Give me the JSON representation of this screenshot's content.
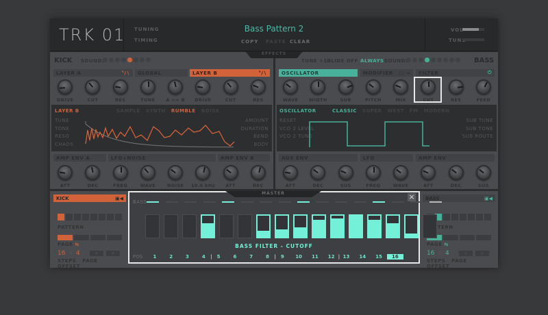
{
  "header": {
    "logo": "TRK 01",
    "tuning": "TUNING",
    "timing": "TIMING",
    "pattern_name": "Bass Pattern 2",
    "copy": "COPY",
    "paste": "PASTE",
    "clear": "CLEAR",
    "vol_label": "VOL",
    "tune_label": "TUNE",
    "vol_level": 0.75,
    "tune_level": 0.0
  },
  "tabs": {
    "effects": "EFFECTS",
    "master": "MASTER"
  },
  "kick": {
    "title": "KICK",
    "sounds": "SOUNDS",
    "sound_count": 8,
    "sound_active": 5,
    "sections": [
      {
        "label": "LAYER A"
      },
      {
        "label": "GLOBAL"
      },
      {
        "label": "LAYER B"
      }
    ],
    "knobs": [
      {
        "label": "DRIVE",
        "value": 0.15
      },
      {
        "label": "CUT",
        "value": 0.35
      },
      {
        "label": "RES",
        "value": 0.2
      },
      {
        "label": "TUNE",
        "value": 0.5
      },
      {
        "label": "A <> B",
        "value": 0.45
      },
      {
        "label": "DRIVE",
        "value": 0.2
      },
      {
        "label": "CUT",
        "value": 0.35
      },
      {
        "label": "RES",
        "value": 0.25
      }
    ],
    "display": {
      "title": "LAYER B",
      "modes": [
        "SAMPLE",
        "SYNTH",
        "RUMBLE",
        "NOISE"
      ],
      "active_mode": "RUMBLE",
      "left_params": [
        "TUNE",
        "TONE",
        "RESO",
        "CHAOS"
      ],
      "right_params": [
        "AMOUNT",
        "DURATION",
        "BEND",
        "BODY"
      ]
    },
    "env_sections": [
      {
        "label": "AMP ENV A"
      },
      {
        "label": "LFO+NOISE"
      },
      {
        "label": "AMP ENV B"
      }
    ],
    "env_knobs": [
      {
        "label": "ATT",
        "value": 0.2
      },
      {
        "label": "DEC",
        "value": 0.45
      },
      {
        "label": "FREQ",
        "value": 0.5
      },
      {
        "label": "WAVE",
        "value": 0.35
      },
      {
        "label": "NOISE",
        "value": 0.3
      },
      {
        "label": "10.0 kHz",
        "value": 0.55
      },
      {
        "label": "ATT",
        "value": 0.3
      },
      {
        "label": "DEC",
        "value": 0.55
      }
    ]
  },
  "bass": {
    "title": "BASS",
    "tune": "TUNE +12",
    "glide": "GLIDE OFF",
    "always": "ALWAYS",
    "sounds": "SOUNDS",
    "sound_count": 9,
    "sound_active": 4,
    "sections": [
      {
        "label": "OSCILLATOR"
      },
      {
        "label": "MODIFIER"
      },
      {
        "label": "FILTER"
      }
    ],
    "knobs": [
      {
        "label": "WAVE",
        "value": 0.3
      },
      {
        "label": "WIDTH",
        "value": 0.5
      },
      {
        "label": "SUB",
        "value": 0.75
      },
      {
        "label": "PITCH",
        "value": 0.3
      },
      {
        "label": "MIX",
        "value": 0.25
      },
      {
        "label": "CUT",
        "value": 0.5
      },
      {
        "label": "RES",
        "value": 0.8
      },
      {
        "label": "FEED",
        "value": 0.6
      }
    ],
    "display": {
      "title": "OSCILLATOR",
      "modes": [
        "CLASSIC",
        "SUPER",
        "WEST",
        "FM",
        "MODERN"
      ],
      "active_mode": "CLASSIC",
      "left_params": [
        "RESET",
        "VCO 2 LEVEL",
        "VCO 2 TUNE"
      ],
      "right_params": [
        "SUB TUNE",
        "SUB TONE",
        "SUB ROUTE"
      ]
    },
    "env_sections": [
      {
        "label": "AUX ENV"
      },
      {
        "label": "LFO"
      },
      {
        "label": "AMP ENV"
      }
    ],
    "env_knobs": [
      {
        "label": "ATT",
        "value": 0.2
      },
      {
        "label": "DEC",
        "value": 0.3
      },
      {
        "label": "SUS",
        "value": 0.25
      },
      {
        "label": "FREQ",
        "value": 0.5
      },
      {
        "label": "WAVE",
        "value": 0.3
      },
      {
        "label": "ATT",
        "value": 0.25
      },
      {
        "label": "DEC",
        "value": 0.3
      },
      {
        "label": "SUS",
        "value": 0.3
      }
    ]
  },
  "seq_kick": {
    "title": "KICK",
    "pattern": "PATTERN",
    "page": "PAGE",
    "steps": "16",
    "page_count": "4",
    "x": "×",
    "steps_label": "STEPS",
    "page_label": "PAGE",
    "offset_label": "OFFSET",
    "prev": "«",
    "next": "»",
    "active_pattern": 1
  },
  "seq_bass": {
    "title": "BASS",
    "pattern": "PATTERN",
    "page": "PAGE",
    "steps": "16",
    "page_count": "4",
    "x": "×",
    "steps_label": "STEPS",
    "page_label": "PAGE",
    "offset_label": "OFFSET",
    "prev": "«",
    "next": "»",
    "active_pattern": 2
  },
  "master": {
    "track": "BASS",
    "param": "BASS FILTER - CUTOFF",
    "pos_label": "POS",
    "close": "×",
    "steps": [
      {
        "n": "1",
        "v": 0,
        "on": false
      },
      {
        "n": "2",
        "v": 0,
        "on": false
      },
      {
        "n": "3",
        "v": 0,
        "on": false
      },
      {
        "n": "4",
        "v": 0.65,
        "on": true
      },
      {
        "n": "5",
        "v": 0,
        "on": false
      },
      {
        "n": "6",
        "v": 0,
        "on": false
      },
      {
        "n": "7",
        "v": 0.28,
        "on": true
      },
      {
        "n": "8",
        "v": 0.35,
        "on": true
      },
      {
        "n": "9",
        "v": 0.45,
        "on": true
      },
      {
        "n": "10",
        "v": 0.8,
        "on": true
      },
      {
        "n": "11",
        "v": 0.88,
        "on": true
      },
      {
        "n": "12",
        "v": 1,
        "on": true
      },
      {
        "n": "13",
        "v": 0.8,
        "on": true
      },
      {
        "n": "14",
        "v": 0.65,
        "on": true
      },
      {
        "n": "15",
        "v": 0.15,
        "on": true
      },
      {
        "n": "16",
        "v": 0,
        "on": false
      }
    ],
    "current_pos": "16"
  },
  "colors": {
    "accent_teal": "#74f0d8",
    "accent_orange": "#d2623a"
  }
}
